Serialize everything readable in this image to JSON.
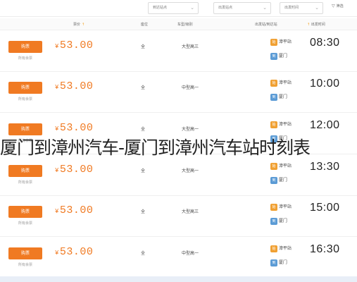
{
  "filters": [
    {
      "label": "到达站点"
    },
    {
      "label": "出发站点"
    },
    {
      "label": "出发时间"
    }
  ],
  "filter_button": "筛选",
  "header": {
    "price": "票价",
    "seat": "座位",
    "vehicle": "车型/级别",
    "stations": "出发站/到达站",
    "departure": "出发时间"
  },
  "caption": "厦门到漳州汽车-厦门到漳州汽车站时刻表",
  "rows": [
    {
      "time": "08:30",
      "price": "53.00",
      "seat": "全",
      "vehicle": "大型高三",
      "from": "漳平站",
      "to": "厦门",
      "buy": "购票",
      "sub": "所有余票"
    },
    {
      "time": "10:00",
      "price": "53.00",
      "seat": "全",
      "vehicle": "中型高一",
      "from": "漳平站",
      "to": "厦门",
      "buy": "购票",
      "sub": "所有余票"
    },
    {
      "time": "12:00",
      "price": "53.00",
      "seat": "全",
      "vehicle": "大型高一",
      "from": "漳平站",
      "to": "厦门",
      "buy": "购票",
      "sub": "所有余票"
    },
    {
      "time": "13:30",
      "price": "53.00",
      "seat": "全",
      "vehicle": "大型高一",
      "from": "漳平站",
      "to": "厦门",
      "buy": "购票",
      "sub": "所有余票"
    },
    {
      "time": "15:00",
      "price": "53.00",
      "seat": "全",
      "vehicle": "大型高三",
      "from": "漳平站",
      "to": "厦门",
      "buy": "购票",
      "sub": "所有余票"
    },
    {
      "time": "16:30",
      "price": "53.00",
      "seat": "全",
      "vehicle": "中型高一",
      "from": "漳平站",
      "to": "厦门",
      "buy": "购票",
      "sub": "所有余票"
    }
  ],
  "currency_symbol": "¥"
}
